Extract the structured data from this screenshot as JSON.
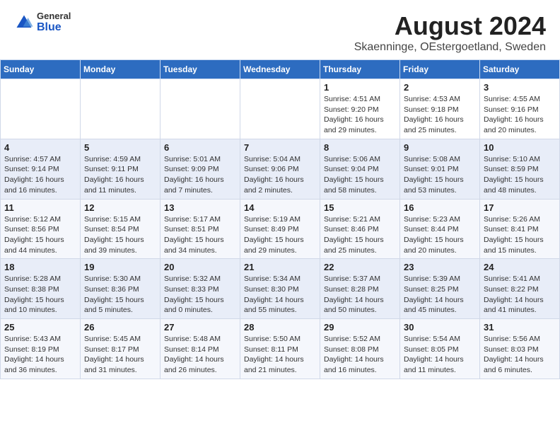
{
  "header": {
    "logo_general": "General",
    "logo_blue": "Blue",
    "title": "August 2024",
    "subtitle": "Skaenninge, OEstergoetland, Sweden"
  },
  "calendar": {
    "days_of_week": [
      "Sunday",
      "Monday",
      "Tuesday",
      "Wednesday",
      "Thursday",
      "Friday",
      "Saturday"
    ],
    "weeks": [
      {
        "row_class": "row-first",
        "days": [
          {
            "num": "",
            "info": ""
          },
          {
            "num": "",
            "info": ""
          },
          {
            "num": "",
            "info": ""
          },
          {
            "num": "",
            "info": ""
          },
          {
            "num": "1",
            "info": "Sunrise: 4:51 AM\nSunset: 9:20 PM\nDaylight: 16 hours\nand 29 minutes."
          },
          {
            "num": "2",
            "info": "Sunrise: 4:53 AM\nSunset: 9:18 PM\nDaylight: 16 hours\nand 25 minutes."
          },
          {
            "num": "3",
            "info": "Sunrise: 4:55 AM\nSunset: 9:16 PM\nDaylight: 16 hours\nand 20 minutes."
          }
        ]
      },
      {
        "row_class": "row-odd",
        "days": [
          {
            "num": "4",
            "info": "Sunrise: 4:57 AM\nSunset: 9:14 PM\nDaylight: 16 hours\nand 16 minutes."
          },
          {
            "num": "5",
            "info": "Sunrise: 4:59 AM\nSunset: 9:11 PM\nDaylight: 16 hours\nand 11 minutes."
          },
          {
            "num": "6",
            "info": "Sunrise: 5:01 AM\nSunset: 9:09 PM\nDaylight: 16 hours\nand 7 minutes."
          },
          {
            "num": "7",
            "info": "Sunrise: 5:04 AM\nSunset: 9:06 PM\nDaylight: 16 hours\nand 2 minutes."
          },
          {
            "num": "8",
            "info": "Sunrise: 5:06 AM\nSunset: 9:04 PM\nDaylight: 15 hours\nand 58 minutes."
          },
          {
            "num": "9",
            "info": "Sunrise: 5:08 AM\nSunset: 9:01 PM\nDaylight: 15 hours\nand 53 minutes."
          },
          {
            "num": "10",
            "info": "Sunrise: 5:10 AM\nSunset: 8:59 PM\nDaylight: 15 hours\nand 48 minutes."
          }
        ]
      },
      {
        "row_class": "row-even",
        "days": [
          {
            "num": "11",
            "info": "Sunrise: 5:12 AM\nSunset: 8:56 PM\nDaylight: 15 hours\nand 44 minutes."
          },
          {
            "num": "12",
            "info": "Sunrise: 5:15 AM\nSunset: 8:54 PM\nDaylight: 15 hours\nand 39 minutes."
          },
          {
            "num": "13",
            "info": "Sunrise: 5:17 AM\nSunset: 8:51 PM\nDaylight: 15 hours\nand 34 minutes."
          },
          {
            "num": "14",
            "info": "Sunrise: 5:19 AM\nSunset: 8:49 PM\nDaylight: 15 hours\nand 29 minutes."
          },
          {
            "num": "15",
            "info": "Sunrise: 5:21 AM\nSunset: 8:46 PM\nDaylight: 15 hours\nand 25 minutes."
          },
          {
            "num": "16",
            "info": "Sunrise: 5:23 AM\nSunset: 8:44 PM\nDaylight: 15 hours\nand 20 minutes."
          },
          {
            "num": "17",
            "info": "Sunrise: 5:26 AM\nSunset: 8:41 PM\nDaylight: 15 hours\nand 15 minutes."
          }
        ]
      },
      {
        "row_class": "row-odd",
        "days": [
          {
            "num": "18",
            "info": "Sunrise: 5:28 AM\nSunset: 8:38 PM\nDaylight: 15 hours\nand 10 minutes."
          },
          {
            "num": "19",
            "info": "Sunrise: 5:30 AM\nSunset: 8:36 PM\nDaylight: 15 hours\nand 5 minutes."
          },
          {
            "num": "20",
            "info": "Sunrise: 5:32 AM\nSunset: 8:33 PM\nDaylight: 15 hours\nand 0 minutes."
          },
          {
            "num": "21",
            "info": "Sunrise: 5:34 AM\nSunset: 8:30 PM\nDaylight: 14 hours\nand 55 minutes."
          },
          {
            "num": "22",
            "info": "Sunrise: 5:37 AM\nSunset: 8:28 PM\nDaylight: 14 hours\nand 50 minutes."
          },
          {
            "num": "23",
            "info": "Sunrise: 5:39 AM\nSunset: 8:25 PM\nDaylight: 14 hours\nand 45 minutes."
          },
          {
            "num": "24",
            "info": "Sunrise: 5:41 AM\nSunset: 8:22 PM\nDaylight: 14 hours\nand 41 minutes."
          }
        ]
      },
      {
        "row_class": "row-even",
        "days": [
          {
            "num": "25",
            "info": "Sunrise: 5:43 AM\nSunset: 8:19 PM\nDaylight: 14 hours\nand 36 minutes."
          },
          {
            "num": "26",
            "info": "Sunrise: 5:45 AM\nSunset: 8:17 PM\nDaylight: 14 hours\nand 31 minutes."
          },
          {
            "num": "27",
            "info": "Sunrise: 5:48 AM\nSunset: 8:14 PM\nDaylight: 14 hours\nand 26 minutes."
          },
          {
            "num": "28",
            "info": "Sunrise: 5:50 AM\nSunset: 8:11 PM\nDaylight: 14 hours\nand 21 minutes."
          },
          {
            "num": "29",
            "info": "Sunrise: 5:52 AM\nSunset: 8:08 PM\nDaylight: 14 hours\nand 16 minutes."
          },
          {
            "num": "30",
            "info": "Sunrise: 5:54 AM\nSunset: 8:05 PM\nDaylight: 14 hours\nand 11 minutes."
          },
          {
            "num": "31",
            "info": "Sunrise: 5:56 AM\nSunset: 8:03 PM\nDaylight: 14 hours\nand 6 minutes."
          }
        ]
      }
    ]
  }
}
